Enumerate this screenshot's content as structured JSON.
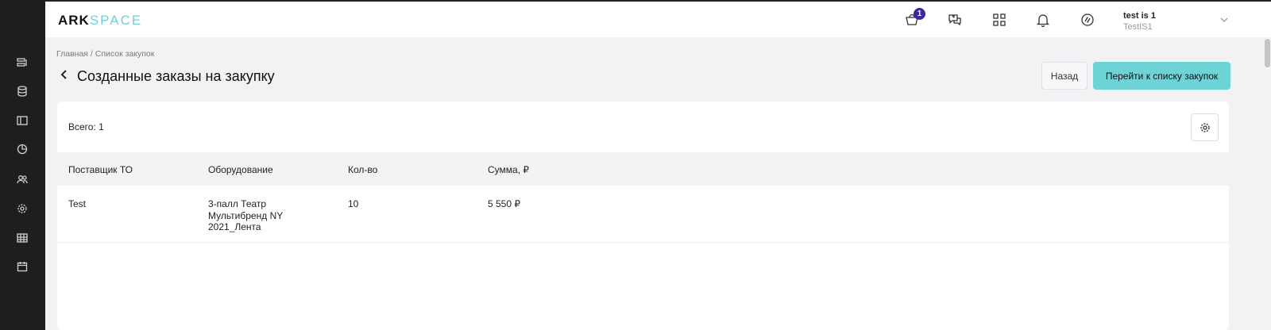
{
  "app": {
    "logo_part1": "ARK",
    "logo_part2": "SPACE"
  },
  "sidebar": {
    "items": [
      {
        "icon": "list-icon"
      },
      {
        "icon": "database-icon"
      },
      {
        "icon": "layout-icon"
      },
      {
        "icon": "pie-chart-icon"
      },
      {
        "icon": "users-icon"
      },
      {
        "icon": "gear-icon"
      },
      {
        "icon": "table-icon"
      },
      {
        "icon": "calendar-icon"
      }
    ]
  },
  "topbar": {
    "cart_count": "1",
    "user_name": "test is 1",
    "user_sub": "TestIS1"
  },
  "breadcrumb": {
    "home": "Главная",
    "separator": " / ",
    "current": "Список закупок"
  },
  "page": {
    "title": "Созданные заказы на закупку",
    "back_button": "Назад",
    "primary_button": "Перейти к списку закупок"
  },
  "table": {
    "total_label": "Всего: 1",
    "columns": [
      "Поставщик ТО",
      "Оборудование",
      "Кол-во",
      "Сумма, ₽"
    ],
    "rows": [
      {
        "supplier": "Test",
        "equipment": "3-палл Театр Мультибренд NY 2021_Лента",
        "quantity": "10",
        "sum": "5 550 ₽"
      }
    ]
  },
  "colors": {
    "accent": "#6dd3d6",
    "badge": "#3b2a9c",
    "sidebar": "#1e1e1e"
  }
}
